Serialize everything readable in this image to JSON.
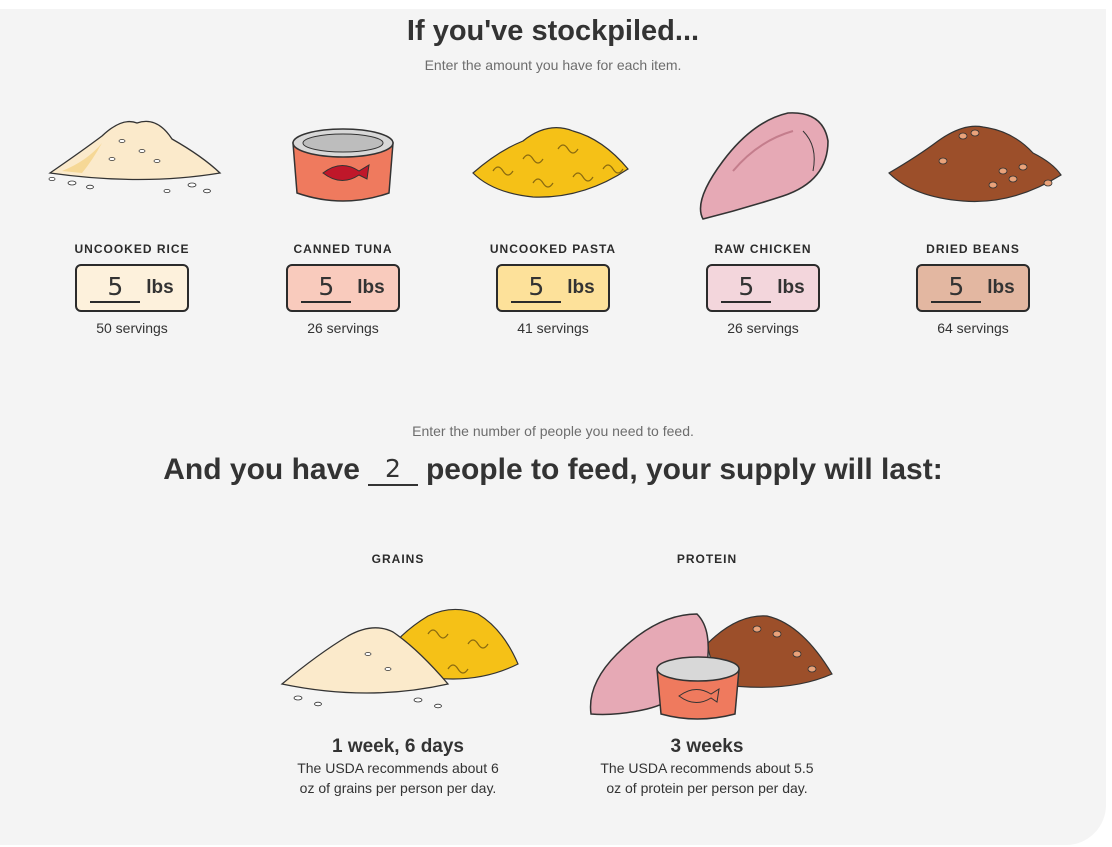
{
  "header": {
    "title": "If you've stockpiled...",
    "subtitle": "Enter the amount you have for each item."
  },
  "items": [
    {
      "label": "UNCOOKED RICE",
      "amount": "5",
      "unit": "lbs",
      "servings": "50 servings",
      "color": "#fdf1dc",
      "icon": "rice-pile-icon"
    },
    {
      "label": "CANNED TUNA",
      "amount": "5",
      "unit": "lbs",
      "servings": "26 servings",
      "color": "#f9cbbd",
      "icon": "tuna-can-icon"
    },
    {
      "label": "UNCOOKED PASTA",
      "amount": "5",
      "unit": "lbs",
      "servings": "41 servings",
      "color": "#fde19a",
      "icon": "pasta-pile-icon"
    },
    {
      "label": "RAW CHICKEN",
      "amount": "5",
      "unit": "lbs",
      "servings": "26 servings",
      "color": "#f3d6dc",
      "icon": "chicken-breast-icon"
    },
    {
      "label": "DRIED BEANS",
      "amount": "5",
      "unit": "lbs",
      "servings": "64 servings",
      "color": "#e3b7a1",
      "icon": "beans-pile-icon"
    }
  ],
  "people": {
    "hint": "Enter the number of people you need to feed.",
    "prefix": "And you have",
    "count": "2",
    "suffix": "people to feed, your supply will last:"
  },
  "results": [
    {
      "label": "GRAINS",
      "duration": "1 week, 6 days",
      "note": "The USDA recommends about 6 oz of grains per person per day.",
      "icon": "grains-pile-icon"
    },
    {
      "label": "PROTEIN",
      "duration": "3 weeks",
      "note": "The USDA recommends about 5.5 oz of protein per person per day.",
      "icon": "protein-pile-icon"
    }
  ]
}
